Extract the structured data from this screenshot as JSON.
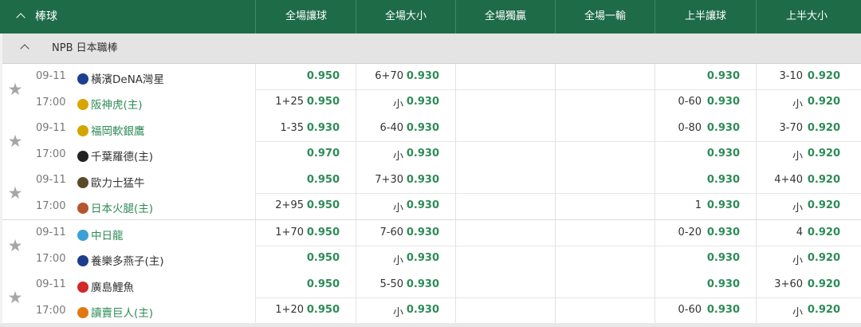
{
  "header": {
    "sport": "棒球",
    "columns": [
      "全場讓球",
      "全場大小",
      "全場獨贏",
      "全場一輸",
      "上半讓球",
      "上半大小"
    ]
  },
  "league": {
    "name": "NPB 日本職棒"
  },
  "matches": [
    {
      "date": "09-11",
      "time": "17:00",
      "team1": "橫濱DeNA灣星",
      "team2": "阪神虎(主)",
      "home": 2,
      "logo1": "#1d3f8f",
      "logo2": "#d9a400",
      "ah_hc1": "",
      "ah_o1": "0.950",
      "ah_hc2": "1+25",
      "ah_o2": "0.950",
      "ou_hc1": "6+70",
      "ou_o1": "0.930",
      "ou_hc2": "小",
      "ou_o2": "0.930",
      "hah_hc1": "",
      "hah_o1": "0.930",
      "hah_hc2": "0-60",
      "hah_o2": "0.930",
      "hou_hc1": "3-10",
      "hou_o1": "0.920",
      "hou_hc2": "小",
      "hou_o2": "0.920"
    },
    {
      "date": "09-11",
      "time": "17:00",
      "team1": "福岡軟銀鷹",
      "team2": "千葉羅德(主)",
      "home": 1,
      "logo1": "#d2a500",
      "logo2": "#222222",
      "ah_hc1": "1-35",
      "ah_o1": "0.930",
      "ah_hc2": "",
      "ah_o2": "0.970",
      "ou_hc1": "6-40",
      "ou_o1": "0.930",
      "ou_hc2": "小",
      "ou_o2": "0.930",
      "hah_hc1": "0-80",
      "hah_o1": "0.930",
      "hah_hc2": "",
      "hah_o2": "0.930",
      "hou_hc1": "3-70",
      "hou_o1": "0.920",
      "hou_hc2": "小",
      "hou_o2": "0.920"
    },
    {
      "date": "09-11",
      "time": "17:00",
      "team1": "歐力士猛牛",
      "team2": "日本火腿(主)",
      "home": 2,
      "logo1": "#5a4a2a",
      "logo2": "#b5542e",
      "ah_hc1": "",
      "ah_o1": "0.950",
      "ah_hc2": "2+95",
      "ah_o2": "0.950",
      "ou_hc1": "7+30",
      "ou_o1": "0.930",
      "ou_hc2": "小",
      "ou_o2": "0.930",
      "hah_hc1": "",
      "hah_o1": "0.930",
      "hah_hc2": "1",
      "hah_o2": "0.930",
      "hou_hc1": "4+40",
      "hou_o1": "0.920",
      "hou_hc2": "小",
      "hou_o2": "0.920"
    },
    {
      "date": "09-11",
      "time": "17:00",
      "team1": "中日龍",
      "team2": "養樂多燕子(主)",
      "home": 1,
      "logo1": "#3aa0d8",
      "logo2": "#1b3d8c",
      "ah_hc1": "1+70",
      "ah_o1": "0.950",
      "ah_hc2": "",
      "ah_o2": "0.950",
      "ou_hc1": "7-60",
      "ou_o1": "0.930",
      "ou_hc2": "小",
      "ou_o2": "0.930",
      "hah_hc1": "0-20",
      "hah_o1": "0.930",
      "hah_hc2": "",
      "hah_o2": "0.930",
      "hou_hc1": "4",
      "hou_o1": "0.920",
      "hou_hc2": "小",
      "hou_o2": "0.920"
    },
    {
      "date": "09-11",
      "time": "17:00",
      "team1": "廣島鯉魚",
      "team2": "讀賣巨人(主)",
      "home": 2,
      "logo1": "#d22828",
      "logo2": "#e07a10",
      "ah_hc1": "",
      "ah_o1": "0.950",
      "ah_hc2": "1+20",
      "ah_o2": "0.950",
      "ou_hc1": "5-50",
      "ou_o1": "0.930",
      "ou_hc2": "小",
      "ou_o2": "0.930",
      "hah_hc1": "",
      "hah_o1": "0.930",
      "hah_hc2": "0-60",
      "hah_o2": "0.930",
      "hou_hc1": "3+60",
      "hou_o1": "0.920",
      "hou_hc2": "小",
      "hou_o2": "0.920"
    }
  ],
  "icons": {
    "collapse": "chevron-up-icon",
    "favorite": "star-icon"
  },
  "colors": {
    "header": "#1e6b47",
    "odds": "#2e8b57"
  }
}
